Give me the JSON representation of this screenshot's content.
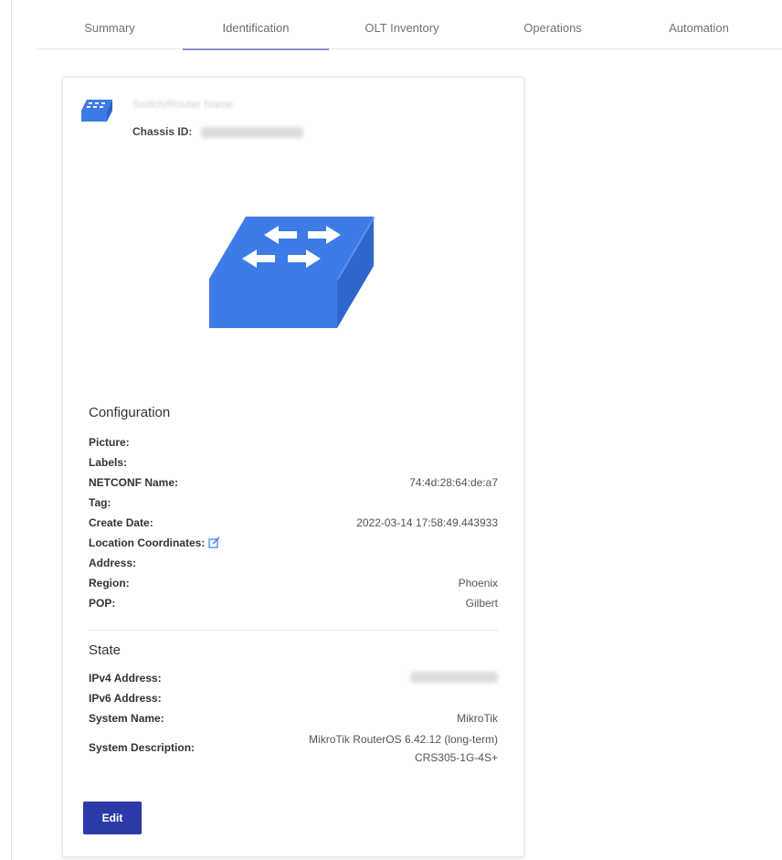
{
  "tabs": [
    {
      "label": "Summary"
    },
    {
      "label": "Identification"
    },
    {
      "label": "OLT Inventory"
    },
    {
      "label": "Operations"
    },
    {
      "label": "Automation"
    }
  ],
  "active_tab": "Identification",
  "device": {
    "name": "Switch/Router Name",
    "chassis_label": "Chassis ID:",
    "icon": "switch-icon"
  },
  "configuration": {
    "title": "Configuration",
    "rows": [
      {
        "label": "Picture:",
        "value": ""
      },
      {
        "label": "Labels:",
        "value": ""
      },
      {
        "label": "NETCONF Name:",
        "value": "74:4d:28:64:de:a7"
      },
      {
        "label": "Tag:",
        "value": ""
      },
      {
        "label": "Create Date:",
        "value": "2022-03-14 17:58:49.443933"
      },
      {
        "label": "Location Coordinates:",
        "value": ""
      },
      {
        "label": "Address:",
        "value": ""
      },
      {
        "label": "Region:",
        "value": "Phoenix"
      },
      {
        "label": "POP:",
        "value": "Gilbert"
      }
    ]
  },
  "state": {
    "title": "State",
    "rows": [
      {
        "label": "IPv4 Address:",
        "value": ""
      },
      {
        "label": "IPv6 Address:",
        "value": ""
      },
      {
        "label": "System Name:",
        "value": "MikroTik"
      },
      {
        "label": "System Description:",
        "value_line1": "MikroTik RouterOS 6.42.12 (long-term)",
        "value_line2": "CRS305-1G-4S+"
      }
    ]
  },
  "actions": {
    "edit_label": "Edit"
  },
  "colors": {
    "accent": "#2b3aa8",
    "switch_blue": "#3d7be6",
    "tab_underline": "#8a8fc8"
  }
}
